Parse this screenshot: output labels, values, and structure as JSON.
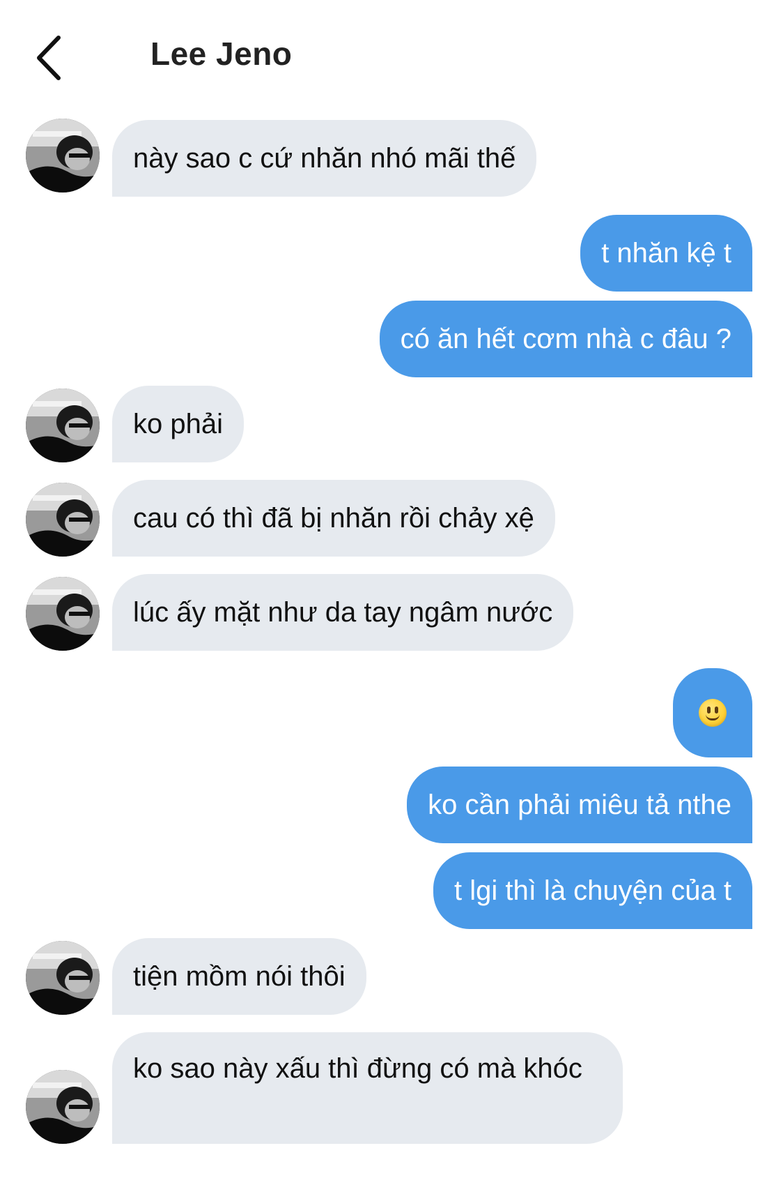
{
  "header": {
    "title": "Lee Jeno",
    "back_icon": "chevron-left-icon"
  },
  "colors": {
    "incoming_bubble": "#e6eaef",
    "outgoing_bubble": "#4a9ae8",
    "outgoing_text": "#ffffff",
    "incoming_text": "#111111"
  },
  "messages": [
    {
      "side": "incoming",
      "text": "này sao c cứ nhăn nhó mãi thế"
    },
    {
      "side": "outgoing",
      "text": "t nhăn kệ t"
    },
    {
      "side": "outgoing",
      "text": "có ăn hết cơm nhà c đâu ?"
    },
    {
      "side": "incoming",
      "text": "ko phải"
    },
    {
      "side": "incoming",
      "text": "cau có thì đã bị nhăn rồi chảy xệ"
    },
    {
      "side": "incoming",
      "text": "lúc ấy mặt như da tay ngâm nước"
    },
    {
      "side": "outgoing",
      "emoji": "slightly-smiling-face-icon"
    },
    {
      "side": "outgoing",
      "text": "ko cần phải miêu tả nthe"
    },
    {
      "side": "outgoing",
      "text": "t lgi thì là chuyện của t"
    },
    {
      "side": "incoming",
      "text": "tiện mồm nói thôi"
    },
    {
      "side": "incoming",
      "text": "ko sao này xấu thì đừng có mà khóc"
    }
  ]
}
